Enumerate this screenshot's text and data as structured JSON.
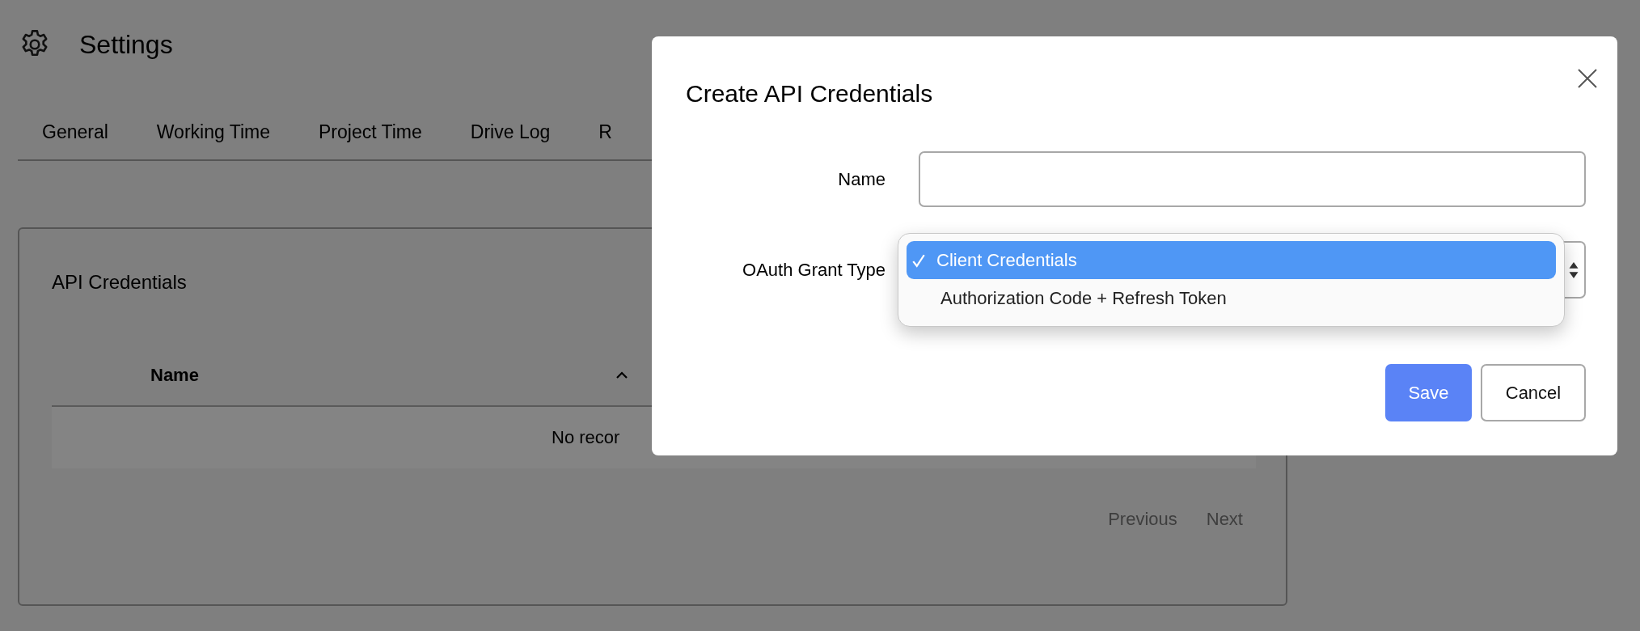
{
  "header": {
    "title": "Settings"
  },
  "tabs": [
    {
      "label": "General"
    },
    {
      "label": "Working Time"
    },
    {
      "label": "Project Time"
    },
    {
      "label": "Drive Log"
    },
    {
      "label": "R"
    }
  ],
  "card": {
    "title": "API Credentials",
    "table": {
      "columns": [
        {
          "label": "Name",
          "sort_ascending": true
        }
      ],
      "empty_text": "No recor"
    },
    "pagination": [
      {
        "label": "Previous",
        "disabled": true
      },
      {
        "label": "Next",
        "disabled": true
      }
    ]
  },
  "dialog": {
    "title": "Create API Credentials",
    "fields": [
      {
        "kind": "text",
        "label": "Name"
      },
      {
        "kind": "select",
        "label": "OAuth Grant Type",
        "open": true,
        "options": [
          {
            "label": "Client Credentials",
            "selected": true
          },
          {
            "label": "Authorization Code + Refresh Token",
            "selected": false
          }
        ]
      }
    ],
    "buttons": [
      {
        "label": "Save",
        "kind": "primary"
      },
      {
        "label": "Cancel",
        "kind": "secondary"
      }
    ]
  }
}
